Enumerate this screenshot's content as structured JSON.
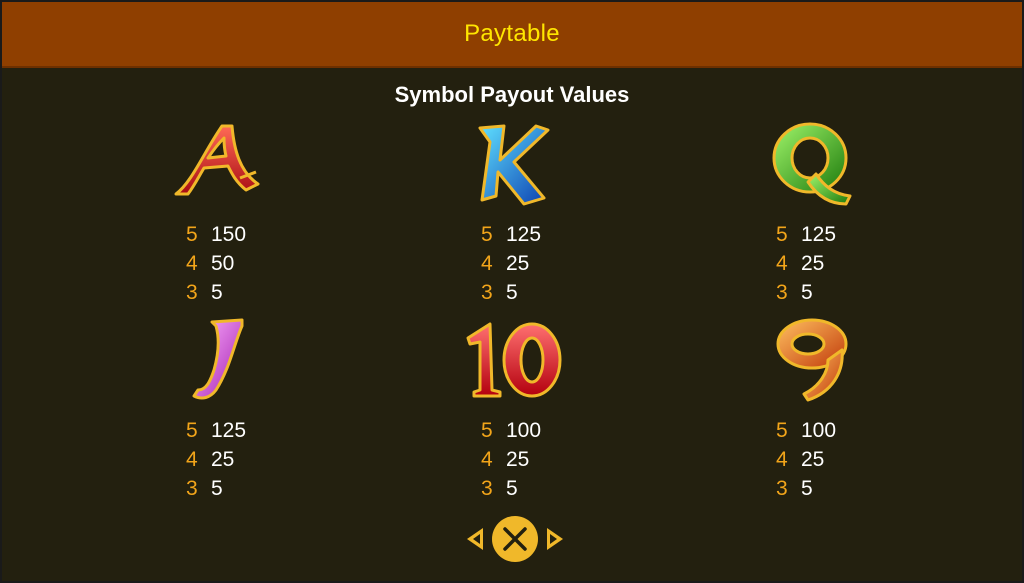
{
  "header": {
    "title": "Paytable"
  },
  "section": {
    "title": "Symbol Payout Values"
  },
  "symbols": [
    {
      "icon": "letter-a-icon",
      "glyph": "A",
      "colors": [
        "#ff5a4a",
        "#a80c14"
      ],
      "payouts": [
        {
          "count": "5",
          "value": "150"
        },
        {
          "count": "4",
          "value": "50"
        },
        {
          "count": "3",
          "value": "5"
        }
      ]
    },
    {
      "icon": "letter-k-icon",
      "glyph": "K",
      "colors": [
        "#4fd2ff",
        "#0c3fb0"
      ],
      "payouts": [
        {
          "count": "5",
          "value": "125"
        },
        {
          "count": "4",
          "value": "25"
        },
        {
          "count": "3",
          "value": "5"
        }
      ]
    },
    {
      "icon": "letter-q-icon",
      "glyph": "Q",
      "colors": [
        "#8ef05a",
        "#1d7a0c"
      ],
      "payouts": [
        {
          "count": "5",
          "value": "125"
        },
        {
          "count": "4",
          "value": "25"
        },
        {
          "count": "3",
          "value": "5"
        }
      ]
    },
    {
      "icon": "letter-j-icon",
      "glyph": "J",
      "colors": [
        "#f59bf5",
        "#a21fb0"
      ],
      "payouts": [
        {
          "count": "5",
          "value": "125"
        },
        {
          "count": "4",
          "value": "25"
        },
        {
          "count": "3",
          "value": "5"
        }
      ]
    },
    {
      "icon": "number-10-icon",
      "glyph": "10",
      "colors": [
        "#ff6a6a",
        "#b3000e"
      ],
      "payouts": [
        {
          "count": "5",
          "value": "100"
        },
        {
          "count": "4",
          "value": "25"
        },
        {
          "count": "3",
          "value": "5"
        }
      ]
    },
    {
      "icon": "number-9-icon",
      "glyph": "9",
      "colors": [
        "#ffb04a",
        "#c0390a"
      ],
      "payouts": [
        {
          "count": "5",
          "value": "100"
        },
        {
          "count": "4",
          "value": "25"
        },
        {
          "count": "3",
          "value": "5"
        }
      ]
    }
  ],
  "colors": {
    "accent": "#ffe600",
    "count": "#f2a51a",
    "gold": "#f0b82a",
    "header_bg": "#8f3f00",
    "panel_bg": "#23200f"
  },
  "nav": {
    "prev_icon": "chevron-left-icon",
    "close_icon": "close-icon",
    "next_icon": "chevron-right-icon"
  }
}
